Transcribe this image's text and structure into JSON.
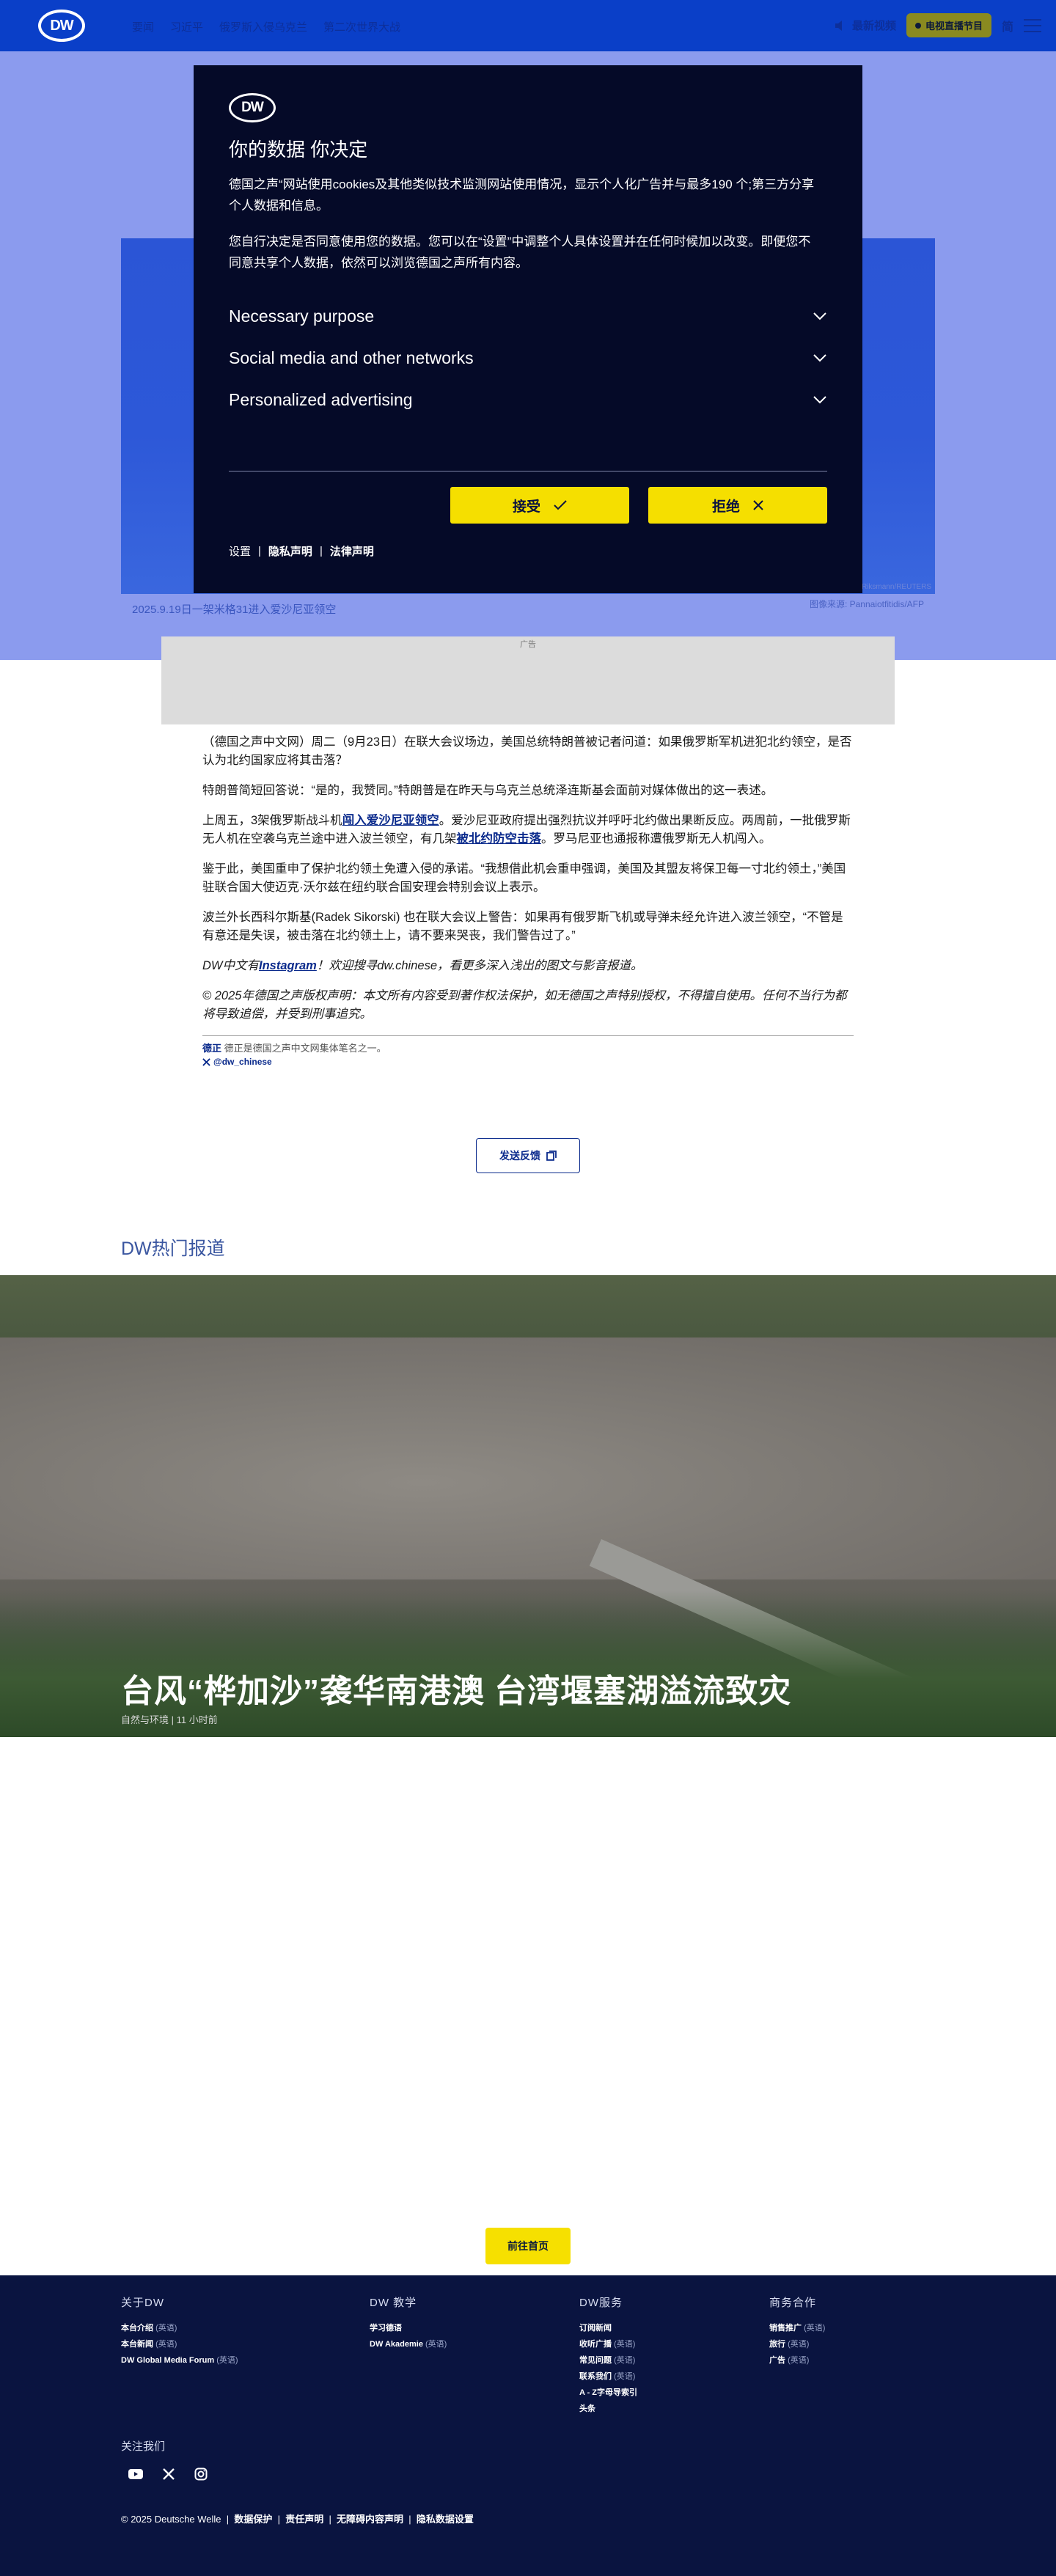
{
  "header": {
    "logo_text": "DW",
    "nav": [
      "要闻",
      "习近平",
      "俄罗斯入侵乌克兰",
      "第二次世界大战"
    ],
    "media_label": "最新视频",
    "live_label": "电视直播节目",
    "lang_label": "简"
  },
  "hero": {
    "caption": "2025.9.19日一架米格31进入爱沙尼亚领空",
    "credit": "图像来源: Pannaiotfitidis/AFP",
    "credit_small": "© Riksmann/REUTERS"
  },
  "ad": {
    "label": "广告"
  },
  "article": {
    "p1": "（德国之声中文网）周二（9月23日）在联大会议场边，美国总统特朗普被记者问道：如果俄罗斯军机进犯北约领空，是否认为北约国家应将其击落？",
    "p2": "特朗普简短回答说：“是的，我赞同。”特朗普是在昨天与乌克兰总统泽连斯基会面前对媒体做出的这一表述。",
    "p3_a": "上周五，3架俄罗斯战斗机",
    "p3_link1": "闯入爱沙尼亚领空",
    "p3_b": "。爱沙尼亚政府提出强烈抗议并呼吁北约做出果断反应。两周前，一批俄罗斯无人机在空袭乌克兰途中进入波兰领空，有几架",
    "p3_link2": "被北约防空击落",
    "p3_c": "。罗马尼亚也通报称遭俄罗斯无人机闯入。",
    "p4": "鉴于此，美国重申了保护北约领土免遭入侵的承诺。“我想借此机会重申强调，美国及其盟友将保卫每一寸北约领土，”美国驻联合国大使迈克·沃尔兹在纽约联合国安理会特别会议上表示。",
    "p5": "波兰外长西科尔斯基(Radek Sikorski) 也在联大会议上警告：如果再有俄罗斯飞机或导弹未经允许进入波兰领空，“不管是有意还是失误，被击落在北约领土上，请不要来哭丧，我们警告过了。”",
    "p6_a": "DW中文有",
    "p6_link": "Instagram",
    "p6_b": "！欢迎搜寻dw.chinese，看更多深入浅出的图文与影音报道。",
    "p7": "© 2025年德国之声版权声明：本文所有内容受到著作权法保护，如无德国之声特别授权，不得擅自使用。任何不当行为都将导致追偿，并受到刑事追究。",
    "author_name": "德正",
    "author_desc": "德正是德国之声中文网集体笔名之一。",
    "twitter": "@dw_chinese",
    "feedback": "发送反馈"
  },
  "trending": {
    "title": "DW热门报道",
    "headline": "台风“桦加沙”袭华南港澳 台湾堰塞湖溢流致灾",
    "meta": "自然与环境 | 11 小时前"
  },
  "home_button": "前往首页",
  "footer": {
    "col1": {
      "title": "关于DW",
      "items": [
        [
          "本台介绍",
          "(英语)"
        ],
        [
          "本台新闻",
          "(英语)"
        ],
        [
          "DW Global Media Forum",
          "(英语)"
        ]
      ]
    },
    "col2": {
      "title": "DW 教学",
      "items": [
        [
          "学习德语",
          ""
        ],
        [
          "DW Akademie",
          "(英语)"
        ]
      ]
    },
    "col3": {
      "title": "DW服务",
      "items": [
        [
          "订阅新闻",
          ""
        ],
        [
          "收听广播",
          "(英语)"
        ],
        [
          "常见问题",
          "(英语)"
        ],
        [
          "联系我们",
          "(英语)"
        ],
        [
          "A - Z字母导索引",
          ""
        ],
        [
          "头条",
          ""
        ]
      ]
    },
    "col4": {
      "title": "商务合作",
      "items": [
        [
          "销售推广",
          "(英语)"
        ],
        [
          "旅行",
          "(英语)"
        ],
        [
          "广告",
          "(英语)"
        ]
      ]
    },
    "follow": "关注我们",
    "copyright": "© 2025 Deutsche Welle",
    "links": [
      "数据保护",
      "责任声明",
      "无障碍内容声明",
      "隐私数据设置"
    ]
  },
  "cookie_dialog": {
    "logo_text": "DW",
    "title": "你的数据 你决定",
    "p1": "德国之声“网站使用cookies及其他类似技术监测网站使用情况，显示个人化广告并与最多190 个;第三方分享个人数据和信息。",
    "p2": "您自行决定是否同意使用您的数据。您可以在“设置”中调整个人具体设置并在任何时候加以改变。即便您不同意共享个人数据，依然可以浏览德国之声所有内容。",
    "items": [
      "Necessary purpose",
      "Social media and other networks",
      "Personalized advertising"
    ],
    "accept": "接受",
    "reject": "拒绝",
    "links": [
      "设置",
      "隐私声明",
      "法律声明"
    ]
  }
}
